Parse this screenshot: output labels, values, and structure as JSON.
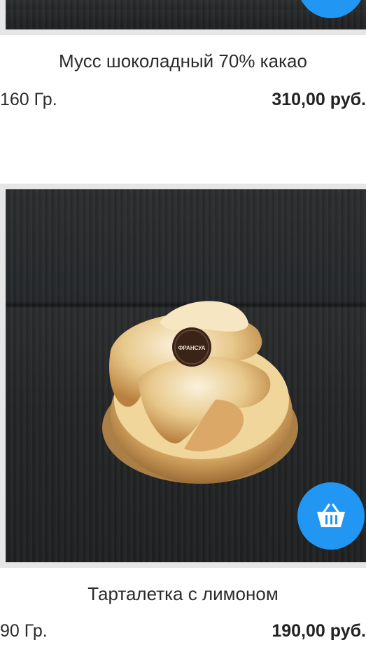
{
  "products": [
    {
      "title": "Мусс шоколадный 70% какао",
      "weight": "160 Гр.",
      "price": "310,00 руб."
    },
    {
      "title": "Тарталетка с лимоном",
      "weight": "90 Гр.",
      "price": "190,00 руб.",
      "badge_text": "ФРАНСУА",
      "cart_icon": "basket-icon"
    }
  ],
  "colors": {
    "accent": "#2196f3",
    "frame": "#e6e6e6"
  }
}
